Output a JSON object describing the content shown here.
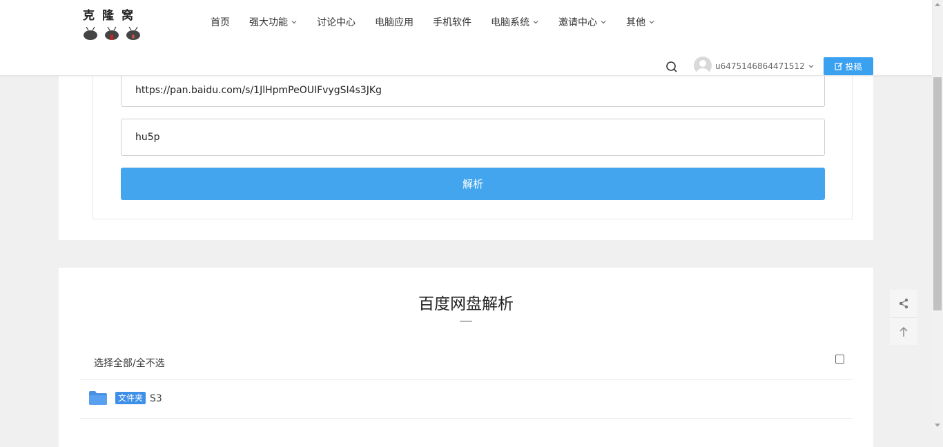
{
  "header": {
    "logo_text": "克隆窝",
    "nav": [
      {
        "label": "首页",
        "has_dropdown": false
      },
      {
        "label": "强大功能",
        "has_dropdown": true
      },
      {
        "label": "讨论中心",
        "has_dropdown": false
      },
      {
        "label": "电脑应用",
        "has_dropdown": false
      },
      {
        "label": "手机软件",
        "has_dropdown": false
      },
      {
        "label": "电脑系统",
        "has_dropdown": true
      },
      {
        "label": "邀请中心",
        "has_dropdown": true
      },
      {
        "label": "其他",
        "has_dropdown": true
      }
    ],
    "username": "u6475146864471512",
    "post_label": "投稿"
  },
  "form": {
    "link_value": "https://pan.baidu.com/s/1JlHpmPeOUIFvygSI4s3JKg",
    "code_value": "hu5p",
    "parse_label": "解析"
  },
  "results": {
    "title": "百度网盘解析",
    "select_all_label": "选择全部/全不选",
    "items": [
      {
        "badge": "文件夹",
        "name": "S3"
      }
    ]
  },
  "colors": {
    "accent": "#42a5ee",
    "badge": "#3d8fe8",
    "folder": "#4a90e2"
  }
}
